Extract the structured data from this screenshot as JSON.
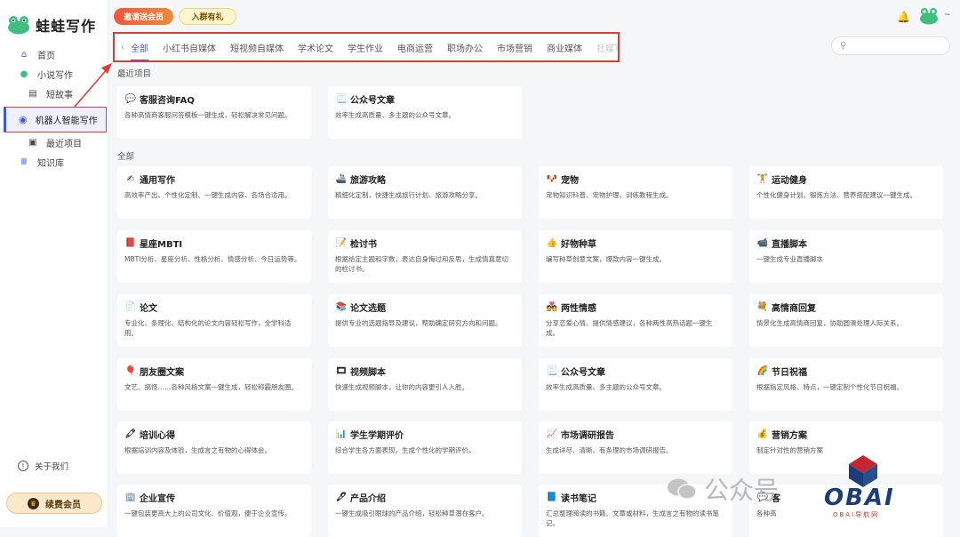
{
  "app": {
    "title": "蛙蛙写作"
  },
  "sidebar": {
    "items": [
      {
        "label": "首页",
        "icon": "home-icon"
      },
      {
        "label": "小说写作",
        "icon": "frog-icon"
      },
      {
        "label": "短故事",
        "icon": "book-icon"
      },
      {
        "label": "机器人智能写作",
        "icon": "robot-icon"
      },
      {
        "label": "最近项目",
        "icon": "archive-icon"
      },
      {
        "label": "知识库",
        "icon": "library-icon"
      }
    ],
    "about": "关于我们",
    "vip": "续费会员"
  },
  "header": {
    "invite": "邀请送会员",
    "group": "入群有礼"
  },
  "tabs": [
    "全部",
    "小红书自媒体",
    "短视频自媒体",
    "学术论文",
    "学生作业",
    "电商运营",
    "职场办公",
    "市场营销",
    "商业媒体",
    "社媒写作"
  ],
  "search": {
    "placeholder": ""
  },
  "sections": {
    "recent": "最近项目",
    "all": "全部"
  },
  "recent_cards": [
    {
      "icon": "💬",
      "title": "客服咨询FAQ",
      "desc": "各种高情商客服问答模板一键生成，轻松解决常见问题。"
    },
    {
      "icon": "📃",
      "title": "公众号文章",
      "desc": "效率生成高质量、多主题的公众号文章。"
    }
  ],
  "all_cards": [
    {
      "icon": "✍",
      "title": "通用写作",
      "desc": "高效率产出、个性化定制、一键生成内容、各场合适用。"
    },
    {
      "icon": "🚢",
      "title": "旅游攻略",
      "desc": "精细化定制，快捷生成旅行计划、旅游攻略分享。"
    },
    {
      "icon": "🐶",
      "title": "宠物",
      "desc": "宠物知识科普、宠物护理、训练教程生成。"
    },
    {
      "icon": "🏋",
      "title": "运动健身",
      "desc": "个性化健身计划、锻炼方法、营养搭配建议一键生成。"
    },
    {
      "icon": "📕",
      "title": "星座MBTI",
      "desc": "MBTI分析、星座分析、性格分析、情感分析、今日运势等。"
    },
    {
      "icon": "📝",
      "title": "检讨书",
      "desc": "根据给定主题和字数，表达自身悔过和反思，生成情真意切的检讨书。"
    },
    {
      "icon": "👍",
      "title": "好物种草",
      "desc": "编写种草创意文案，爆款内容一键生成。"
    },
    {
      "icon": "📹",
      "title": "直播脚本",
      "desc": "一键生成专业直播脚本"
    },
    {
      "icon": "📄",
      "title": "论文",
      "desc": "专业化、条理化、结构化的论文内容轻松写作，全学科适用。"
    },
    {
      "icon": "📚",
      "title": "论文选题",
      "desc": "提供专业的选题指导及建议，帮助确定研究方向和问题。"
    },
    {
      "icon": "💑",
      "title": "两性情感",
      "desc": "分享恋爱心情、提供情感建议，各种两性高热话题一键生成。"
    },
    {
      "icon": "💐",
      "title": "高情商回复",
      "desc": "情景化生成高情商回复，协助圆滑处理人际关系。"
    },
    {
      "icon": "🎈",
      "title": "朋友圈文案",
      "desc": "文艺、搞怪……各种风格文案一键生成，轻松称霸朋友圈。"
    },
    {
      "icon": "🎞",
      "title": "视频脚本",
      "desc": "快速生成视频脚本，让你的内容更引人入胜。"
    },
    {
      "icon": "📃",
      "title": "公众号文章",
      "desc": "效率生成高质量、多主题的公众号文章。"
    },
    {
      "icon": "🌈",
      "title": "节日祝福",
      "desc": "根据指定风格、特点，一键定制个性化节日祝福。"
    },
    {
      "icon": "🖍",
      "title": "培训心得",
      "desc": "根据培训内容及体验，生成言之有物的心得体会。"
    },
    {
      "icon": "📊",
      "title": "学生学期评价",
      "desc": "综合学生各方面表现，生成个性化的学期评价。"
    },
    {
      "icon": "📈",
      "title": "市场调研报告",
      "desc": "生成详尽、清晰、有条理的市场调研报告。"
    },
    {
      "icon": "💰",
      "title": "营销方案",
      "desc": "制定针对性的营销方案"
    },
    {
      "icon": "🏢",
      "title": "企业宣传",
      "desc": "一键包装更高大上的公司文化、价值观，便于企业宣传。"
    },
    {
      "icon": "🖋",
      "title": "产品介绍",
      "desc": "一键生成吸引眼球的产品介绍，轻松种草潜在客户。"
    },
    {
      "icon": "📘",
      "title": "读书笔记",
      "desc": "汇总整理阅读的书籍、文章或材料，生成言之有物的读书笔记。"
    },
    {
      "icon": "💬",
      "title": "客",
      "desc": "各种高"
    }
  ],
  "watermark": {
    "text": "公众号",
    "brand": "OBAI",
    "brand_sub": "OBAI导航网"
  },
  "colors": {
    "accent": "#3b5bdb",
    "highlight": "#e03b3b",
    "card_bg": "#ffffff"
  }
}
